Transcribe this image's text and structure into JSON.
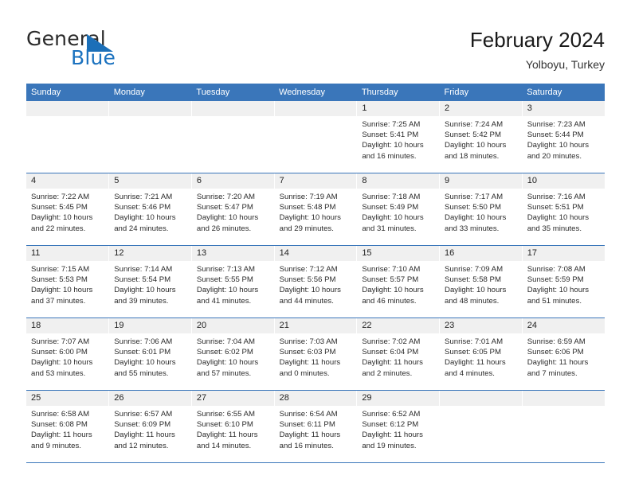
{
  "brand": {
    "name_top": "General",
    "name_bottom": "Blue",
    "triangle_color": "#1b6fb8",
    "blue_color": "#1b72bf"
  },
  "header": {
    "title": "February 2024",
    "subtitle": "Yolboyu, Turkey"
  },
  "theme": {
    "header_bg": "#3a76ba",
    "daynum_bg": "#f0f0f0",
    "row_rule": "#3a76ba",
    "text": "#2b2b2b"
  },
  "weekday_headers": [
    "Sunday",
    "Monday",
    "Tuesday",
    "Wednesday",
    "Thursday",
    "Friday",
    "Saturday"
  ],
  "weeks": [
    [
      {
        "day": "",
        "lines": []
      },
      {
        "day": "",
        "lines": []
      },
      {
        "day": "",
        "lines": []
      },
      {
        "day": "",
        "lines": []
      },
      {
        "day": "1",
        "lines": [
          "Sunrise: 7:25 AM",
          "Sunset: 5:41 PM",
          "Daylight: 10 hours",
          "and 16 minutes."
        ]
      },
      {
        "day": "2",
        "lines": [
          "Sunrise: 7:24 AM",
          "Sunset: 5:42 PM",
          "Daylight: 10 hours",
          "and 18 minutes."
        ]
      },
      {
        "day": "3",
        "lines": [
          "Sunrise: 7:23 AM",
          "Sunset: 5:44 PM",
          "Daylight: 10 hours",
          "and 20 minutes."
        ]
      }
    ],
    [
      {
        "day": "4",
        "lines": [
          "Sunrise: 7:22 AM",
          "Sunset: 5:45 PM",
          "Daylight: 10 hours",
          "and 22 minutes."
        ]
      },
      {
        "day": "5",
        "lines": [
          "Sunrise: 7:21 AM",
          "Sunset: 5:46 PM",
          "Daylight: 10 hours",
          "and 24 minutes."
        ]
      },
      {
        "day": "6",
        "lines": [
          "Sunrise: 7:20 AM",
          "Sunset: 5:47 PM",
          "Daylight: 10 hours",
          "and 26 minutes."
        ]
      },
      {
        "day": "7",
        "lines": [
          "Sunrise: 7:19 AM",
          "Sunset: 5:48 PM",
          "Daylight: 10 hours",
          "and 29 minutes."
        ]
      },
      {
        "day": "8",
        "lines": [
          "Sunrise: 7:18 AM",
          "Sunset: 5:49 PM",
          "Daylight: 10 hours",
          "and 31 minutes."
        ]
      },
      {
        "day": "9",
        "lines": [
          "Sunrise: 7:17 AM",
          "Sunset: 5:50 PM",
          "Daylight: 10 hours",
          "and 33 minutes."
        ]
      },
      {
        "day": "10",
        "lines": [
          "Sunrise: 7:16 AM",
          "Sunset: 5:51 PM",
          "Daylight: 10 hours",
          "and 35 minutes."
        ]
      }
    ],
    [
      {
        "day": "11",
        "lines": [
          "Sunrise: 7:15 AM",
          "Sunset: 5:53 PM",
          "Daylight: 10 hours",
          "and 37 minutes."
        ]
      },
      {
        "day": "12",
        "lines": [
          "Sunrise: 7:14 AM",
          "Sunset: 5:54 PM",
          "Daylight: 10 hours",
          "and 39 minutes."
        ]
      },
      {
        "day": "13",
        "lines": [
          "Sunrise: 7:13 AM",
          "Sunset: 5:55 PM",
          "Daylight: 10 hours",
          "and 41 minutes."
        ]
      },
      {
        "day": "14",
        "lines": [
          "Sunrise: 7:12 AM",
          "Sunset: 5:56 PM",
          "Daylight: 10 hours",
          "and 44 minutes."
        ]
      },
      {
        "day": "15",
        "lines": [
          "Sunrise: 7:10 AM",
          "Sunset: 5:57 PM",
          "Daylight: 10 hours",
          "and 46 minutes."
        ]
      },
      {
        "day": "16",
        "lines": [
          "Sunrise: 7:09 AM",
          "Sunset: 5:58 PM",
          "Daylight: 10 hours",
          "and 48 minutes."
        ]
      },
      {
        "day": "17",
        "lines": [
          "Sunrise: 7:08 AM",
          "Sunset: 5:59 PM",
          "Daylight: 10 hours",
          "and 51 minutes."
        ]
      }
    ],
    [
      {
        "day": "18",
        "lines": [
          "Sunrise: 7:07 AM",
          "Sunset: 6:00 PM",
          "Daylight: 10 hours",
          "and 53 minutes."
        ]
      },
      {
        "day": "19",
        "lines": [
          "Sunrise: 7:06 AM",
          "Sunset: 6:01 PM",
          "Daylight: 10 hours",
          "and 55 minutes."
        ]
      },
      {
        "day": "20",
        "lines": [
          "Sunrise: 7:04 AM",
          "Sunset: 6:02 PM",
          "Daylight: 10 hours",
          "and 57 minutes."
        ]
      },
      {
        "day": "21",
        "lines": [
          "Sunrise: 7:03 AM",
          "Sunset: 6:03 PM",
          "Daylight: 11 hours",
          "and 0 minutes."
        ]
      },
      {
        "day": "22",
        "lines": [
          "Sunrise: 7:02 AM",
          "Sunset: 6:04 PM",
          "Daylight: 11 hours",
          "and 2 minutes."
        ]
      },
      {
        "day": "23",
        "lines": [
          "Sunrise: 7:01 AM",
          "Sunset: 6:05 PM",
          "Daylight: 11 hours",
          "and 4 minutes."
        ]
      },
      {
        "day": "24",
        "lines": [
          "Sunrise: 6:59 AM",
          "Sunset: 6:06 PM",
          "Daylight: 11 hours",
          "and 7 minutes."
        ]
      }
    ],
    [
      {
        "day": "25",
        "lines": [
          "Sunrise: 6:58 AM",
          "Sunset: 6:08 PM",
          "Daylight: 11 hours",
          "and 9 minutes."
        ]
      },
      {
        "day": "26",
        "lines": [
          "Sunrise: 6:57 AM",
          "Sunset: 6:09 PM",
          "Daylight: 11 hours",
          "and 12 minutes."
        ]
      },
      {
        "day": "27",
        "lines": [
          "Sunrise: 6:55 AM",
          "Sunset: 6:10 PM",
          "Daylight: 11 hours",
          "and 14 minutes."
        ]
      },
      {
        "day": "28",
        "lines": [
          "Sunrise: 6:54 AM",
          "Sunset: 6:11 PM",
          "Daylight: 11 hours",
          "and 16 minutes."
        ]
      },
      {
        "day": "29",
        "lines": [
          "Sunrise: 6:52 AM",
          "Sunset: 6:12 PM",
          "Daylight: 11 hours",
          "and 19 minutes."
        ]
      },
      {
        "day": "",
        "lines": []
      },
      {
        "day": "",
        "lines": []
      }
    ]
  ]
}
